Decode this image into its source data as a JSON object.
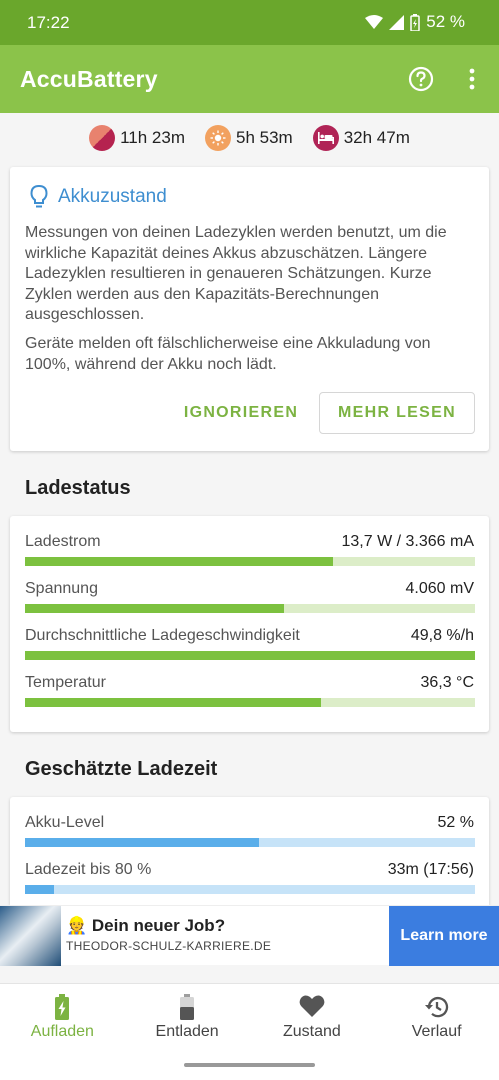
{
  "status_bar": {
    "time": "17:22",
    "battery_percent": "52 %"
  },
  "app": {
    "title": "AccuBattery"
  },
  "summary": [
    {
      "icon": "screen-on-icon",
      "value": "11h 23m"
    },
    {
      "icon": "screen-off-icon",
      "value": "5h 53m"
    },
    {
      "icon": "deep-sleep-icon",
      "value": "32h 47m"
    }
  ],
  "tip": {
    "title": "Akkuzustand",
    "paragraph1": "Messungen von deinen Ladezyklen werden benutzt, um die wirkliche Kapazität deines Akkus abzuschätzen. Längere Ladezyklen resultieren in genaueren Schätzungen. Kurze Zyklen werden aus den Kapazitäts-Berechnungen ausgeschlossen.",
    "paragraph2": "Geräte melden oft fälschlicherweise eine Akkuladung von 100%, während der Akku noch lädt.",
    "ignore_label": "IGNORIEREN",
    "more_label": "MEHR LESEN"
  },
  "charge_status": {
    "title": "Ladestatus",
    "rows": [
      {
        "label": "Ladestrom",
        "value": "13,7 W / 3.366 mA",
        "fraction": 0.684
      },
      {
        "label": "Spannung",
        "value": "4.060 mV",
        "fraction": 0.576
      },
      {
        "label": "Durchschnittliche Ladegeschwindigkeit",
        "value": "49,8 %/h",
        "fraction": 1.0
      },
      {
        "label": "Temperatur",
        "value": "36,3 °C",
        "fraction": 0.658
      }
    ]
  },
  "charge_time": {
    "title": "Geschätzte Ladezeit",
    "rows": [
      {
        "label": "Akku-Level",
        "value": "52 %",
        "fraction": 0.52
      },
      {
        "label": "Ladezeit bis 80 %",
        "value": "33m (17:56)",
        "fraction": 0.065
      }
    ]
  },
  "ad": {
    "title": "Dein neuer Job?",
    "url": "THEODOR-SCHULZ-KARRIERE.DE",
    "button": "Learn more"
  },
  "nav": [
    {
      "label": "Aufladen",
      "icon": "battery-charging-icon",
      "active": true
    },
    {
      "label": "Entladen",
      "icon": "battery-icon",
      "active": false
    },
    {
      "label": "Zustand",
      "icon": "heart-icon",
      "active": false
    },
    {
      "label": "Verlauf",
      "icon": "history-icon",
      "active": false
    }
  ],
  "colors": {
    "accent": "#8bc34a",
    "status_bar": "#6aa72c",
    "green_bar_fill": "#7cc13f",
    "green_bar_track": "#dcedc8",
    "blue_bar_fill": "#5aaeea",
    "blue_bar_track": "#c6e3f8",
    "link_blue": "#3e8ed0"
  }
}
